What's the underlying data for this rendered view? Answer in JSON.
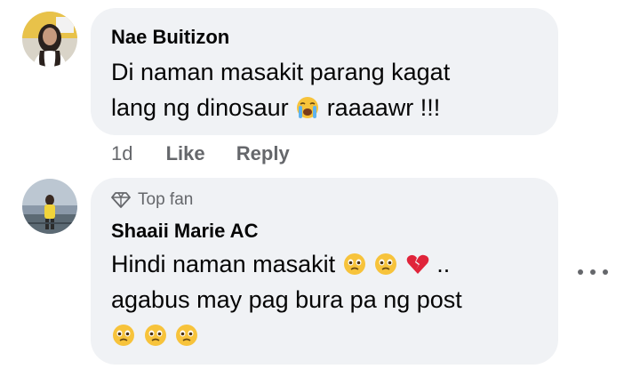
{
  "comments": [
    {
      "author": "Nae Buitizon",
      "line1": "Di naman masakit parang kagat",
      "line2_before": "lang ng dinosaur",
      "line2_after": "raaaawr !!!",
      "time": "1d",
      "like_label": "Like",
      "reply_label": "Reply"
    },
    {
      "badge": "Top fan",
      "author": "Shaaii Marie AC",
      "line1_before": "Hindi naman masakit",
      "line1_after": "..",
      "line2": "agabus may pag bura pa ng post"
    }
  ],
  "icons": {
    "more": "more-horizontal-icon",
    "badge": "diamond-icon",
    "emoji_crying": "loudly-crying-face-emoji",
    "emoji_tear": "face-holding-back-tears-emoji",
    "emoji_heart": "broken-heart-emoji"
  },
  "colors": {
    "bubble": "#f0f2f5",
    "meta_text": "#65676b",
    "text": "#050505"
  }
}
